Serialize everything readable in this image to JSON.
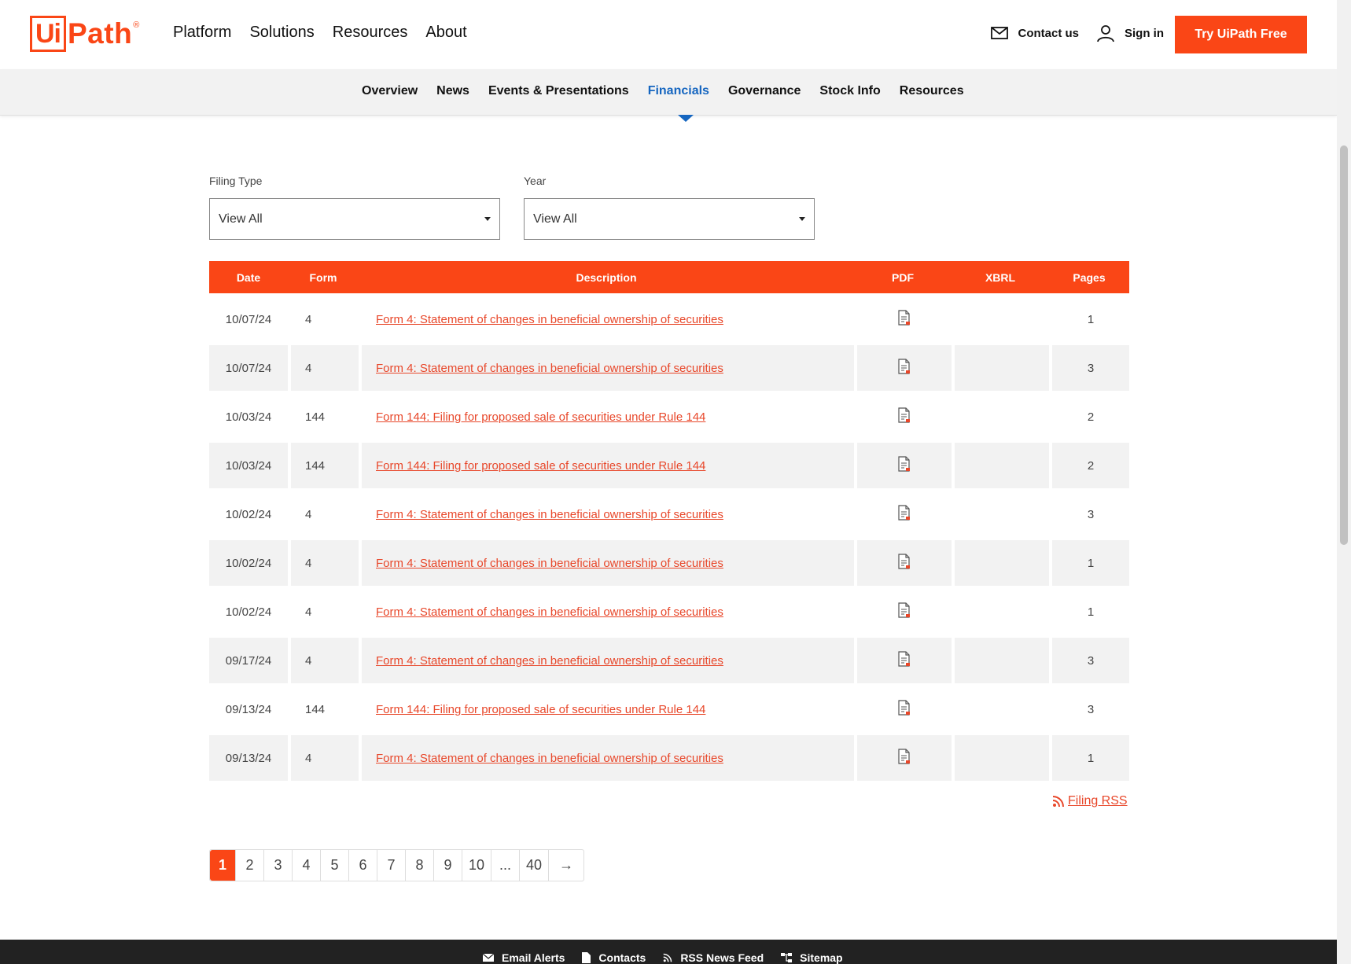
{
  "header": {
    "logo_box": "Ui",
    "logo_text": "Path",
    "logo_reg": "®",
    "nav": [
      "Platform",
      "Solutions",
      "Resources",
      "About"
    ],
    "contact_label": "Contact us",
    "signin_label": "Sign in",
    "cta_label": "Try UiPath Free"
  },
  "subnav": {
    "items": [
      "Overview",
      "News",
      "Events & Presentations",
      "Financials",
      "Governance",
      "Stock Info",
      "Resources"
    ],
    "active": "Financials"
  },
  "filters": {
    "filing_type": {
      "label": "Filing Type",
      "value": "View All"
    },
    "year": {
      "label": "Year",
      "value": "View All"
    }
  },
  "table": {
    "headers": {
      "date": "Date",
      "form": "Form",
      "description": "Description",
      "pdf": "PDF",
      "xbrl": "XBRL",
      "pages": "Pages"
    },
    "rows": [
      {
        "date": "10/07/24",
        "form": "4",
        "description": "Form 4: Statement of changes in beneficial ownership of securities",
        "pages": "1"
      },
      {
        "date": "10/07/24",
        "form": "4",
        "description": "Form 4: Statement of changes in beneficial ownership of securities",
        "pages": "3"
      },
      {
        "date": "10/03/24",
        "form": "144",
        "description": "Form 144: Filing for proposed sale of securities under Rule 144",
        "pages": "2"
      },
      {
        "date": "10/03/24",
        "form": "144",
        "description": "Form 144: Filing for proposed sale of securities under Rule 144",
        "pages": "2"
      },
      {
        "date": "10/02/24",
        "form": "4",
        "description": "Form 4: Statement of changes in beneficial ownership of securities",
        "pages": "3"
      },
      {
        "date": "10/02/24",
        "form": "4",
        "description": "Form 4: Statement of changes in beneficial ownership of securities",
        "pages": "1"
      },
      {
        "date": "10/02/24",
        "form": "4",
        "description": "Form 4: Statement of changes in beneficial ownership of securities",
        "pages": "1"
      },
      {
        "date": "09/17/24",
        "form": "4",
        "description": "Form 4: Statement of changes in beneficial ownership of securities",
        "pages": "3"
      },
      {
        "date": "09/13/24",
        "form": "144",
        "description": "Form 144: Filing for proposed sale of securities under Rule 144",
        "pages": "3"
      },
      {
        "date": "09/13/24",
        "form": "4",
        "description": "Form 4: Statement of changes in beneficial ownership of securities",
        "pages": "1"
      }
    ]
  },
  "rss_label": "Filing RSS",
  "pagination": {
    "pages": [
      "1",
      "2",
      "3",
      "4",
      "5",
      "6",
      "7",
      "8",
      "9",
      "10",
      "...",
      "40"
    ],
    "current": "1",
    "next": "→"
  },
  "footer": {
    "items": [
      "Email Alerts",
      "Contacts",
      "RSS News Feed",
      "Sitemap"
    ]
  },
  "colors": {
    "brand": "#fa4616",
    "link": "#e8472a",
    "active_tab": "#1666c0"
  }
}
